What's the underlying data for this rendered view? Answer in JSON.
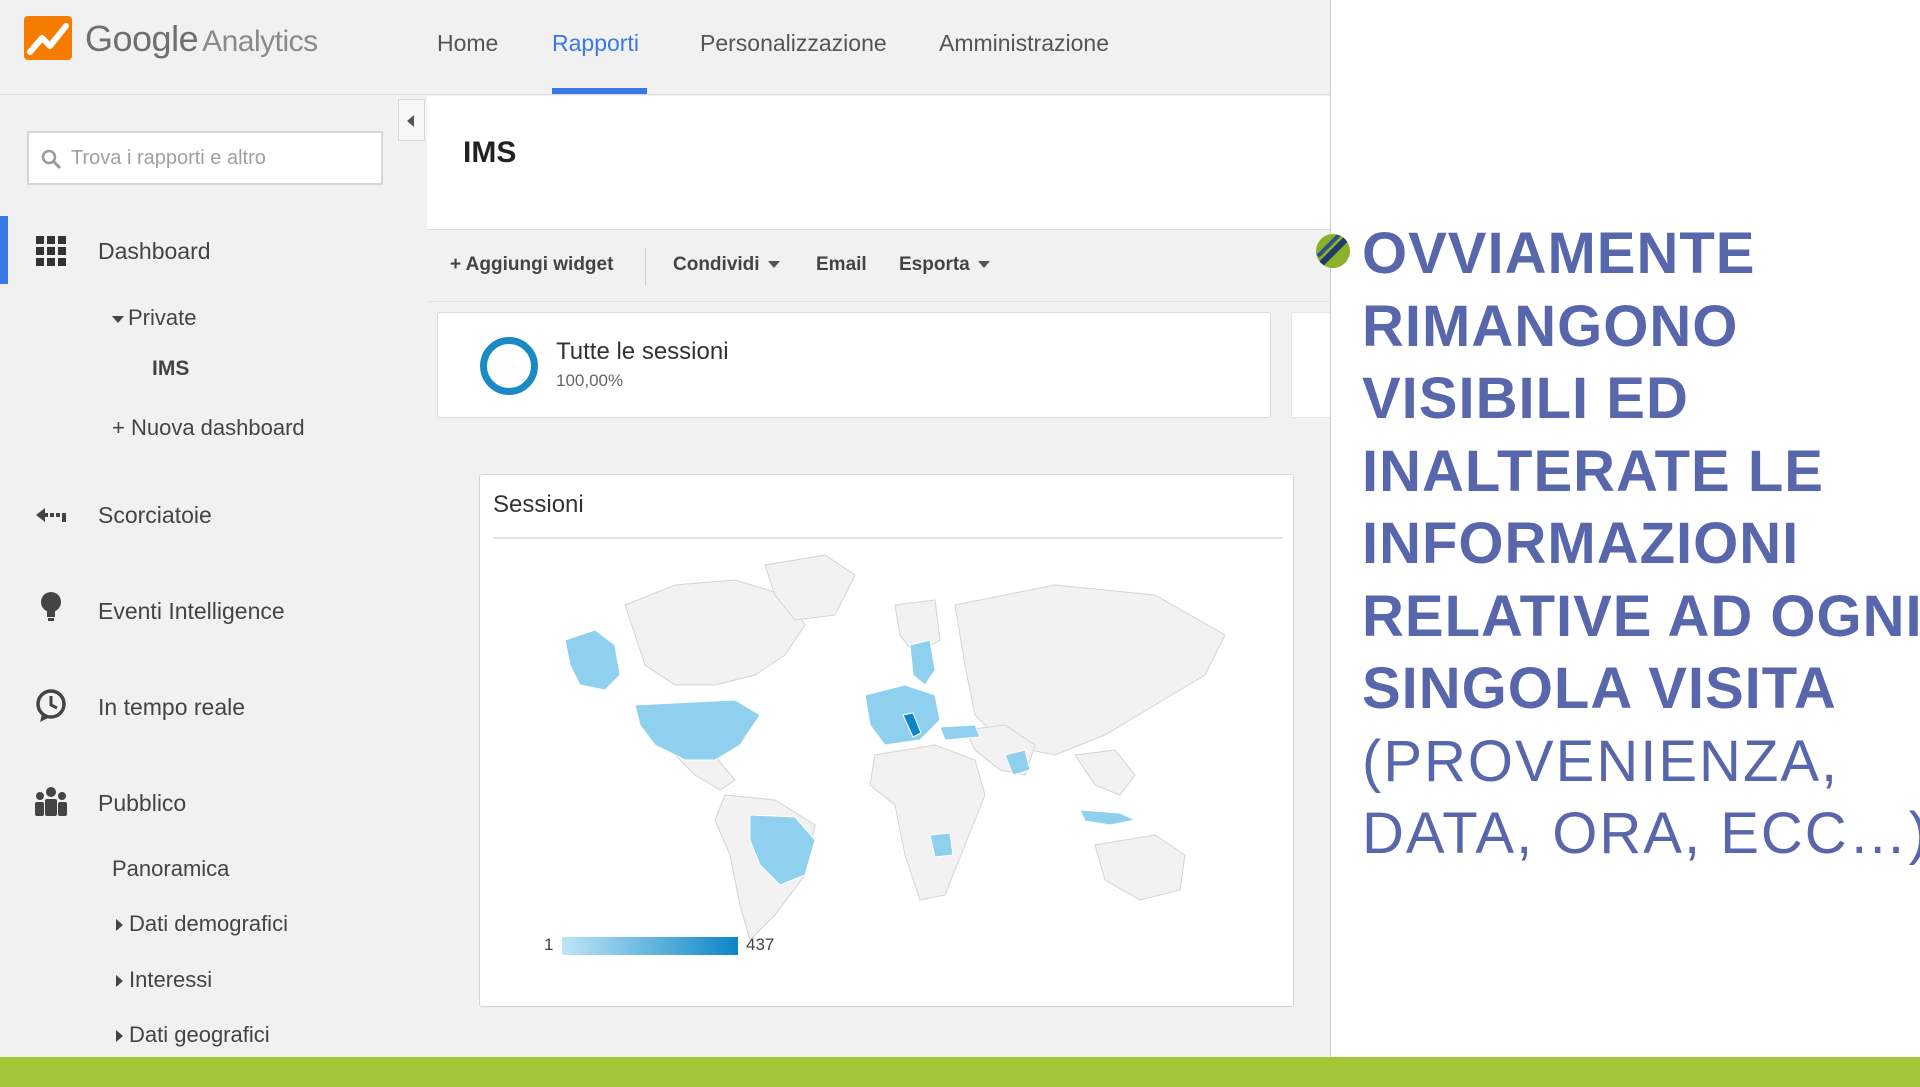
{
  "app": {
    "brand_main": "Google",
    "brand_sub": "Analytics"
  },
  "nav": {
    "items": [
      {
        "label": "Home"
      },
      {
        "label": "Rapporti"
      },
      {
        "label": "Personalizzazione"
      },
      {
        "label": "Amministrazione"
      }
    ],
    "active": "Rapporti"
  },
  "sidebar": {
    "search_placeholder": "Trova i rapporti e altro",
    "dashboard": "Dashboard",
    "private": "Private",
    "ims": "IMS",
    "new_dashboard": "+ Nuova dashboard",
    "shortcuts": "Scorciatoie",
    "intelligence": "Eventi Intelligence",
    "realtime": "In tempo reale",
    "audience": "Pubblico",
    "overview": "Panoramica",
    "demographics": "Dati demografici",
    "interests": "Interessi",
    "geo": "Dati geografici"
  },
  "main": {
    "title": "IMS",
    "toolbar": {
      "add_widget": "+ Aggiungi widget",
      "share": "Condividi",
      "email": "Email",
      "export": "Esporta"
    },
    "segment": {
      "name": "Tutte le sessioni",
      "percent": "100,00%"
    },
    "map_widget": {
      "title": "Sessioni",
      "legend_min": "1",
      "legend_max": "437"
    }
  },
  "slide": {
    "bold_lines": [
      "OVVIAMENTE",
      "RIMANGONO",
      "VISIBILI ED",
      "INALTERATE LE",
      "INFORMAZIONI",
      "RELATIVE AD OGNI",
      "SINGOLA VISITA"
    ],
    "light_lines": [
      "(PROVENIENZA,",
      "DATA, ORA, ECC…)"
    ]
  },
  "colors": {
    "accent": "#3b78e7",
    "slide_text": "#5866ab",
    "band": "#a4c639",
    "map_highlight": "#8fd0ef",
    "map_strong": "#0c86c6"
  }
}
